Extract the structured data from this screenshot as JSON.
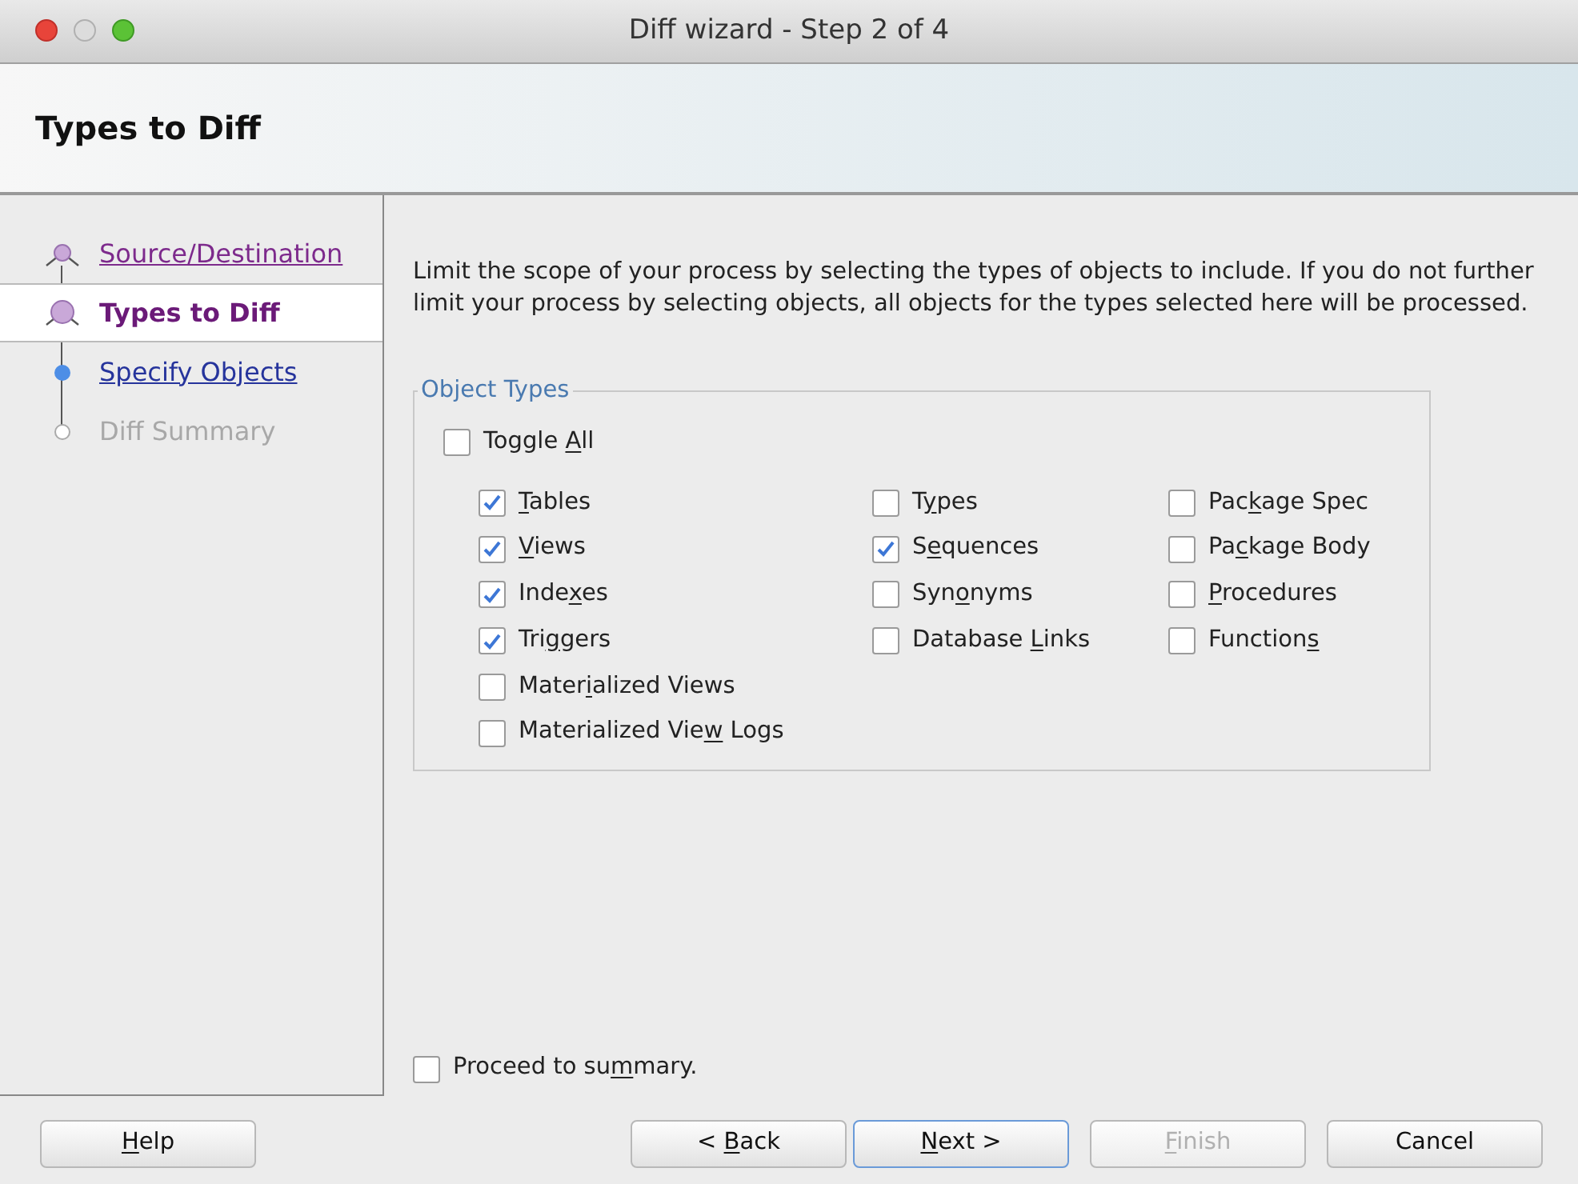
{
  "window": {
    "title": "Diff wizard - Step 2 of 4"
  },
  "header": {
    "title": "Types to Diff"
  },
  "steps": [
    {
      "label": "Source/Destination",
      "kind": "visited",
      "selected": false
    },
    {
      "label": "Types to Diff",
      "kind": "current",
      "selected": true
    },
    {
      "label": "Specify Objects",
      "kind": "link",
      "selected": false
    },
    {
      "label": "Diff Summary",
      "kind": "disabled",
      "selected": false
    }
  ],
  "description": "Limit the scope of your process by selecting the types of objects to include.  If you do not further limit your process by selecting objects, all objects for the types selected here will be processed.",
  "object_types": {
    "title": "Object Types",
    "toggle_all": {
      "checked": false,
      "label_parts": [
        {
          "text": "Toggle ",
          "underline": false
        },
        {
          "text": "A",
          "underline": true
        },
        {
          "text": "ll",
          "underline": false
        }
      ]
    },
    "columns": [
      [
        {
          "checked": true,
          "label_parts": [
            {
              "text": "T",
              "underline": true
            },
            {
              "text": "ables",
              "underline": false
            }
          ]
        },
        {
          "checked": true,
          "label_parts": [
            {
              "text": "V",
              "underline": true
            },
            {
              "text": "iews",
              "underline": false
            }
          ]
        },
        {
          "checked": true,
          "label_parts": [
            {
              "text": "Inde",
              "underline": false
            },
            {
              "text": "x",
              "underline": true
            },
            {
              "text": "es",
              "underline": false
            }
          ]
        },
        {
          "checked": true,
          "label_parts": [
            {
              "text": "Tri",
              "underline": false
            },
            {
              "text": "g",
              "underline": true
            },
            {
              "text": "gers",
              "underline": false
            }
          ]
        },
        {
          "checked": false,
          "label_parts": [
            {
              "text": "Mater",
              "underline": false
            },
            {
              "text": "i",
              "underline": true
            },
            {
              "text": "alized Views",
              "underline": false
            }
          ]
        },
        {
          "checked": false,
          "label_parts": [
            {
              "text": "Materialized Vie",
              "underline": false
            },
            {
              "text": "w",
              "underline": true
            },
            {
              "text": " Logs",
              "underline": false
            }
          ]
        }
      ],
      [
        {
          "checked": false,
          "label_parts": [
            {
              "text": "T",
              "underline": false
            },
            {
              "text": "y",
              "underline": true
            },
            {
              "text": "pes",
              "underline": false
            }
          ]
        },
        {
          "checked": true,
          "label_parts": [
            {
              "text": "S",
              "underline": false
            },
            {
              "text": "e",
              "underline": true
            },
            {
              "text": "quences",
              "underline": false
            }
          ]
        },
        {
          "checked": false,
          "label_parts": [
            {
              "text": "Syn",
              "underline": false
            },
            {
              "text": "o",
              "underline": true
            },
            {
              "text": "nyms",
              "underline": false
            }
          ]
        },
        {
          "checked": false,
          "label_parts": [
            {
              "text": "Database ",
              "underline": false
            },
            {
              "text": "L",
              "underline": true
            },
            {
              "text": "inks",
              "underline": false
            }
          ]
        }
      ],
      [
        {
          "checked": false,
          "label_parts": [
            {
              "text": "Pac",
              "underline": false
            },
            {
              "text": "k",
              "underline": true
            },
            {
              "text": "age Spec",
              "underline": false
            }
          ]
        },
        {
          "checked": false,
          "label_parts": [
            {
              "text": "Pa",
              "underline": false
            },
            {
              "text": "c",
              "underline": true
            },
            {
              "text": "kage Body",
              "underline": false
            }
          ]
        },
        {
          "checked": false,
          "label_parts": [
            {
              "text": "P",
              "underline": true
            },
            {
              "text": "rocedures",
              "underline": false
            }
          ]
        },
        {
          "checked": false,
          "label_parts": [
            {
              "text": "Function",
              "underline": false
            },
            {
              "text": "s",
              "underline": true
            }
          ]
        }
      ]
    ]
  },
  "proceed": {
    "checked": false,
    "label_parts": [
      {
        "text": "Proceed to su",
        "underline": false
      },
      {
        "text": "m",
        "underline": true
      },
      {
        "text": "mary.",
        "underline": false
      }
    ]
  },
  "buttons": [
    {
      "kind": "help",
      "disabled": false,
      "default": false,
      "label_parts": [
        {
          "text": "H",
          "underline": true
        },
        {
          "text": "elp",
          "underline": false
        }
      ]
    },
    {
      "kind": "nav",
      "disabled": false,
      "default": false,
      "label_parts": [
        {
          "text": "< ",
          "underline": false
        },
        {
          "text": "B",
          "underline": true
        },
        {
          "text": "ack",
          "underline": false
        }
      ]
    },
    {
      "kind": "nav",
      "disabled": false,
      "default": true,
      "label_parts": [
        {
          "text": "N",
          "underline": true
        },
        {
          "text": "ext >",
          "underline": false
        }
      ]
    },
    {
      "kind": "nav",
      "disabled": true,
      "default": false,
      "label_parts": [
        {
          "text": "F",
          "underline": true
        },
        {
          "text": "inish",
          "underline": false
        }
      ]
    },
    {
      "kind": "cancel",
      "disabled": false,
      "default": false,
      "label_parts": [
        {
          "text": "Cancel",
          "underline": false
        }
      ]
    }
  ]
}
